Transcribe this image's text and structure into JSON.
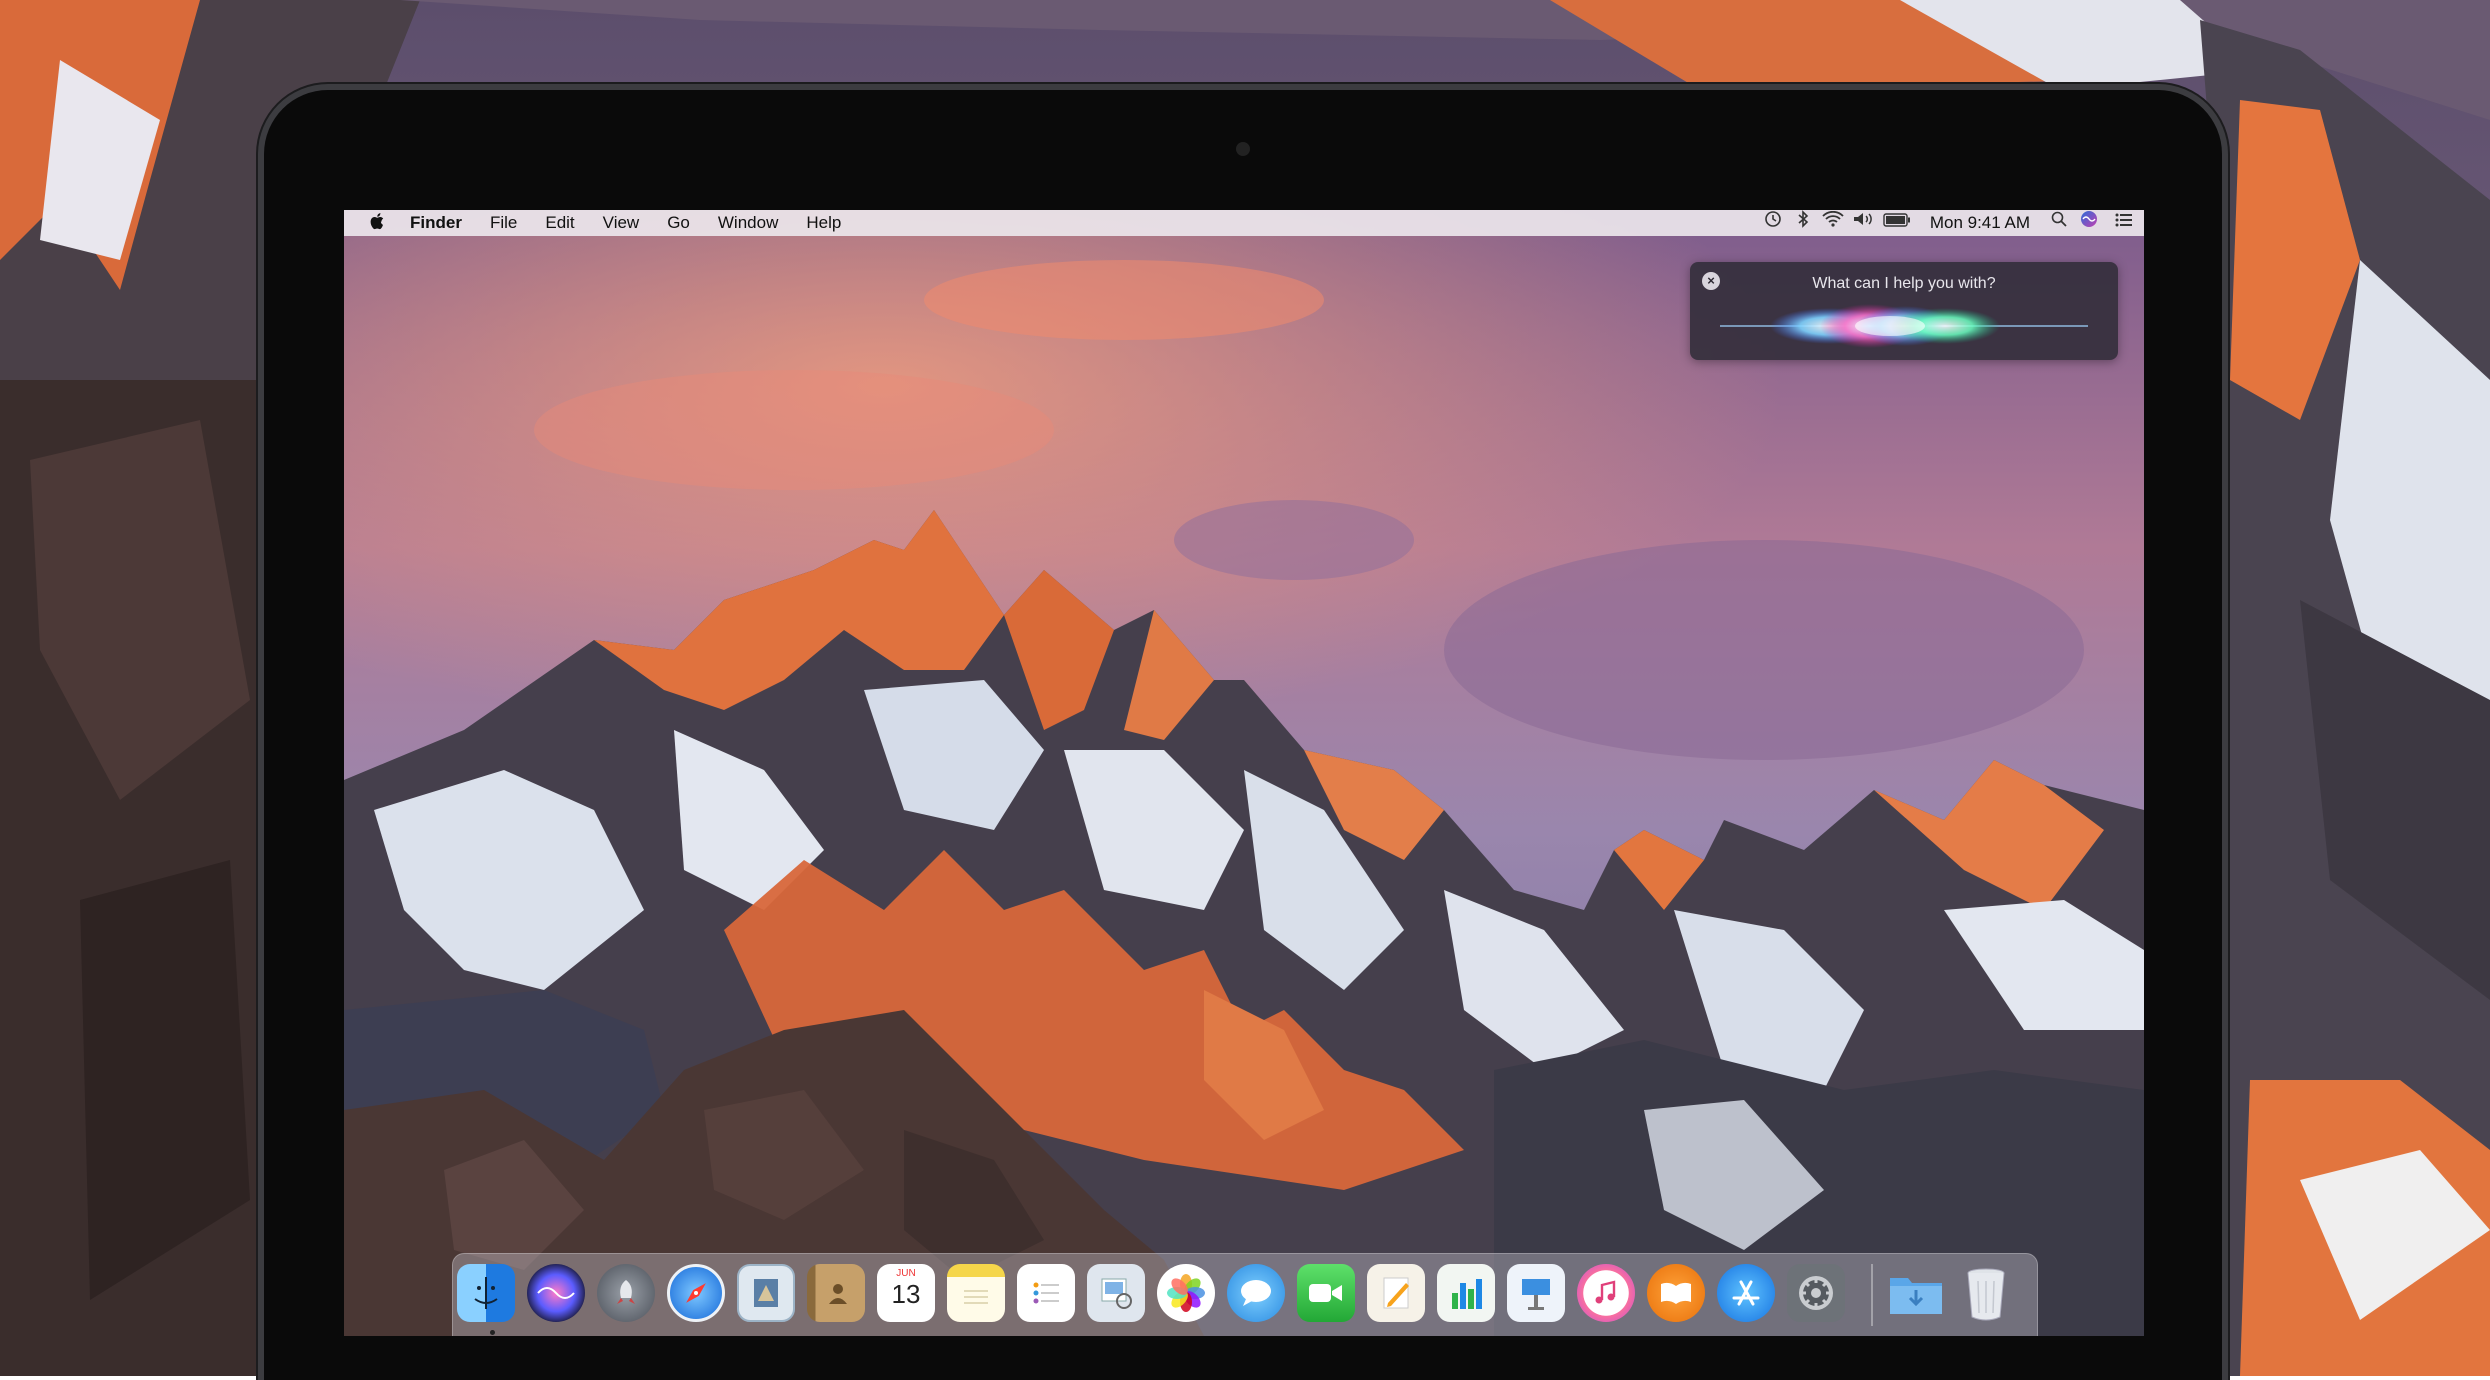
{
  "menubar": {
    "apple_glyph": "",
    "app_name": "Finder",
    "menus": [
      "File",
      "Edit",
      "View",
      "Go",
      "Window",
      "Help"
    ],
    "status_icons": [
      "time-machine-icon",
      "bluetooth-icon",
      "wifi-icon",
      "volume-icon",
      "battery-icon"
    ],
    "clock": "Mon 9:41 AM",
    "right_icons": [
      "spotlight-icon",
      "siri-icon",
      "notification-center-icon"
    ]
  },
  "siri": {
    "prompt": "What can I help you with?",
    "close_glyph": "×"
  },
  "calendar_icon": {
    "month": "JUN",
    "day": "13"
  },
  "dock": {
    "apps": [
      "Finder",
      "Siri",
      "Launchpad",
      "Safari",
      "Mail",
      "Contacts",
      "Calendar",
      "Notes",
      "Reminders",
      "Preview",
      "Photos",
      "Messages",
      "FaceTime",
      "Pages",
      "Numbers",
      "Keynote",
      "iTunes",
      "iBooks",
      "App Store",
      "System Preferences",
      "Downloads",
      "Trash"
    ],
    "running": [
      "Finder"
    ]
  },
  "colors": {
    "sky_top": "#8a5a8a",
    "sunset_glow": "#e98a6a",
    "mountain_lit": "#e0703a",
    "mountain_shadow": "#3a3540",
    "snow": "#dfe4ef"
  }
}
